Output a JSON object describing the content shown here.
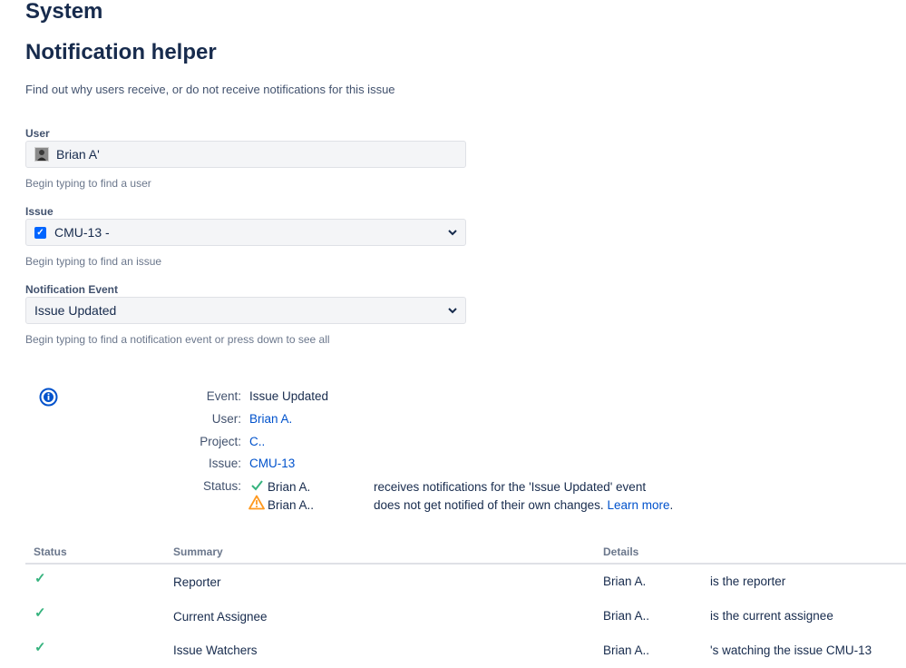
{
  "headings": {
    "section": "System",
    "page_title": "Notification helper",
    "description": "Find out why users receive, or do not receive notifications for this issue"
  },
  "form": {
    "user": {
      "label": "User",
      "value": "Brian A'",
      "help": "Begin typing to find a user"
    },
    "issue": {
      "label": "Issue",
      "value": "CMU-13 -",
      "help": "Begin typing to find an issue"
    },
    "event": {
      "label": "Notification Event",
      "value": "Issue Updated",
      "help": "Begin typing to find a notification event or press down to see all"
    }
  },
  "info": {
    "event_key": "Event:",
    "event_val": "Issue Updated",
    "user_key": "User:",
    "user_val": "Brian A.",
    "project_key": "Project:",
    "project_val": "C..",
    "issue_key": "Issue:",
    "issue_val": "CMU-13",
    "status_key": "Status:",
    "status1_name": "Brian A.",
    "status1_text": "receives notifications for the 'Issue Updated' event",
    "status2_name": "Brian A..",
    "status2_text": "does not get notified of their own changes.",
    "learn_more": "Learn more",
    "learn_more_suffix": "."
  },
  "table": {
    "headers": {
      "status": "Status",
      "summary": "Summary",
      "details": "Details"
    },
    "rows": [
      {
        "summary": "Reporter",
        "name": "Brian A.",
        "detail": "is the reporter"
      },
      {
        "summary": "Current Assignee",
        "name": "Brian A..",
        "detail": "is the current assignee"
      },
      {
        "summary": "Issue Watchers",
        "name": "Brian A..",
        "detail": "'s watching the issue CMU-13"
      }
    ]
  },
  "icons": {
    "info": "info-icon",
    "check": "check-icon",
    "warning": "warning-icon",
    "chevron": "chevron-down-icon",
    "avatar": "avatar-icon"
  },
  "colors": {
    "link": "#0052cc",
    "success": "#36b37e",
    "warning": "#ff991f",
    "checkbox": "#0065ff",
    "field_bg": "#f4f5f7"
  }
}
